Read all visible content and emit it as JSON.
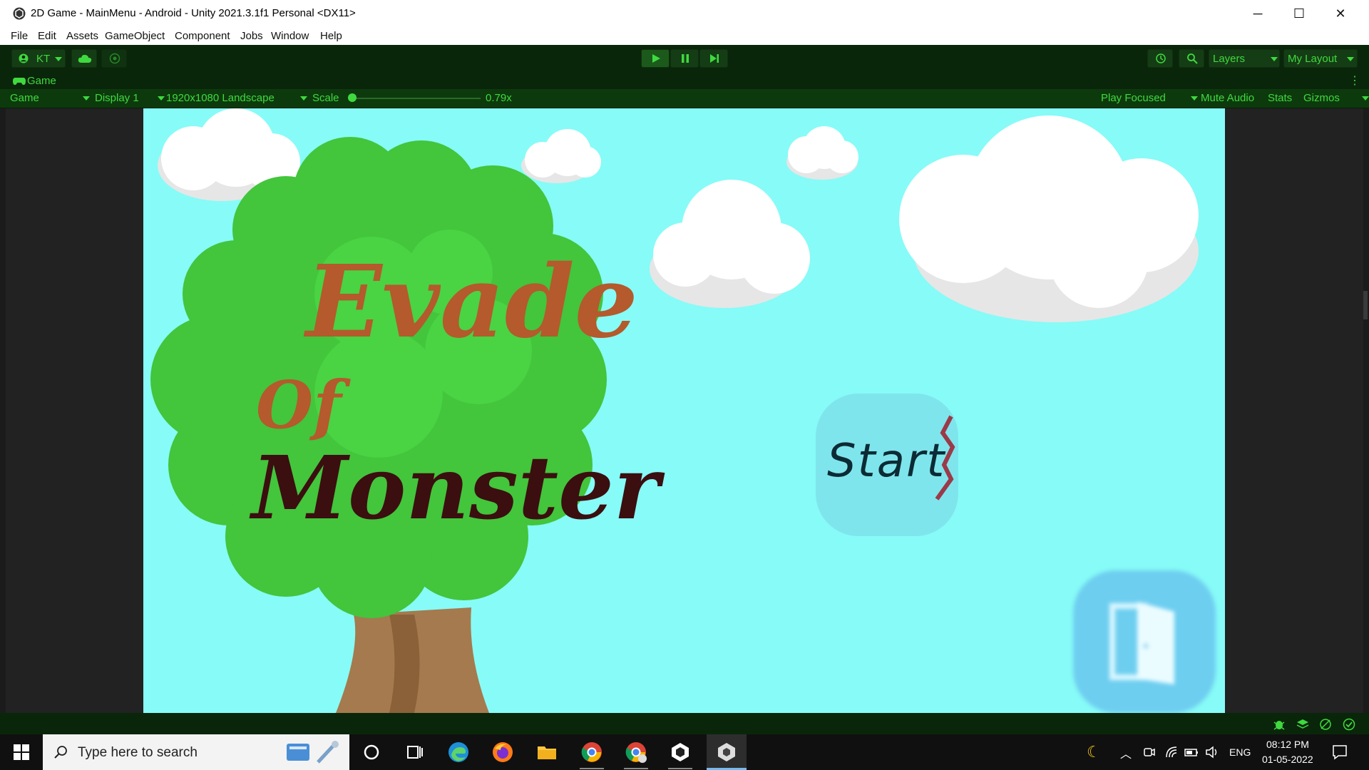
{
  "window": {
    "title": "2D Game - MainMenu - Android - Unity 2021.3.1f1 Personal <DX11>",
    "minimize_glyph": "─",
    "maximize_glyph": "☐",
    "close_glyph": "✕"
  },
  "menu": [
    "File",
    "Edit",
    "Assets",
    "GameObject",
    "Component",
    "Jobs",
    "Window",
    "Help"
  ],
  "toolbar": {
    "account_label": "KT",
    "layers_label": "Layers",
    "layout_label": "My Layout",
    "icons": [
      "account-icon",
      "cloud-icon",
      "collab-icon",
      "play-icon",
      "pause-icon",
      "step-icon",
      "history-icon",
      "search-icon"
    ]
  },
  "tab": {
    "label": "Game",
    "icon": "gamepad-icon"
  },
  "game_controls": {
    "view_mode": "Game",
    "display": "Display 1",
    "resolution": "1920x1080 Landscape",
    "scale_label": "Scale",
    "scale_value": "0.79x",
    "scale_level": 0.0,
    "play_mode": "Play Focused",
    "mute_audio": "Mute Audio",
    "stats": "Stats",
    "gizmos": "Gizmos"
  },
  "game": {
    "title_line1": "Evade",
    "title_line2": "Of",
    "title_line3": "Monster",
    "start_label": "Start",
    "exit_icon": "door-exit-icon",
    "colors": {
      "sky": "#87fbf7",
      "tree": "#43c53c",
      "trunk": "#a47a4e",
      "title_brown": "#b45a2c",
      "title_dark": "#3b0e10"
    }
  },
  "taskbar": {
    "search_placeholder": "Type here to search",
    "time": "08:12 PM",
    "date": "01-05-2022",
    "language": "ENG",
    "apps": [
      "cortana-icon",
      "task-view-icon",
      "edge-icon",
      "firefox-icon",
      "file-explorer-icon",
      "chrome-icon",
      "chrome-profile-icon",
      "unity-hub-icon",
      "unity-editor-icon"
    ]
  },
  "colors": {
    "accent_green": "#3fd93f",
    "toolbar_bg": "#0a260a",
    "taskbar_bg": "#101010"
  }
}
